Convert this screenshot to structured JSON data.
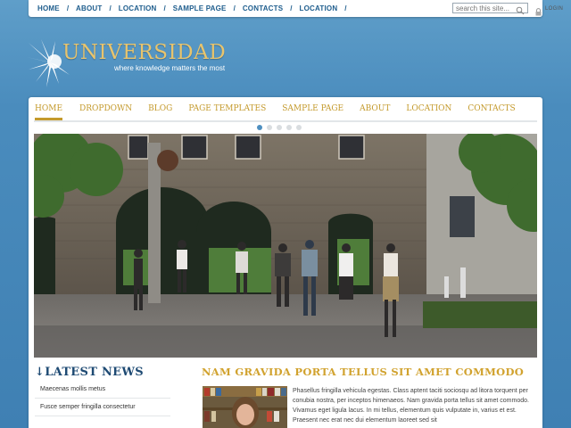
{
  "topnav": {
    "items": [
      "HOME",
      "ABOUT",
      "LOCATION",
      "SAMPLE PAGE",
      "CONTACTS",
      "LOCATION"
    ],
    "separator": "/"
  },
  "search": {
    "placeholder": "search this site...",
    "icon": "search-icon"
  },
  "login": {
    "label": "LOGIN",
    "icon": "lock-icon"
  },
  "brand": {
    "name": "UNIVERSIDAD",
    "tagline": "where knowledge matters the most",
    "logo_icon": "starburst-logo",
    "colors": {
      "brand_gold": "#e8c46d",
      "nav_gold": "#c49a2c",
      "title_blue": "#1e4a73",
      "accent_blue": "#4e8fc0"
    }
  },
  "mainnav": {
    "items": [
      "HOME",
      "DROPDOWN",
      "BLOG",
      "PAGE TEMPLATES",
      "SAMPLE PAGE",
      "ABOUT",
      "LOCATION",
      "CONTACTS"
    ],
    "active_index": 0
  },
  "slider": {
    "total_dots": 5,
    "active_dot": 0
  },
  "news": {
    "title": "LATEST NEWS",
    "icon": "arrow-down-icon",
    "items": [
      "Maecenas mollis metus",
      "Fusce semper fringilla consectetur"
    ]
  },
  "feature": {
    "title": "NAM GRAVIDA PORTA TELLUS SIT AMET COMMODO",
    "text": "Phasellus fringilla vehicula egestas. Class aptent taciti sociosqu ad litora torquent per conubia nostra, per inceptos himenaeos. Nam gravida porta tellus sit amet commodo. Vivamus eget ligula lacus. In mi tellus, elementum quis vulputate in, varius et est. Praesent nec erat nec dui elementum laoreet sed sit"
  }
}
